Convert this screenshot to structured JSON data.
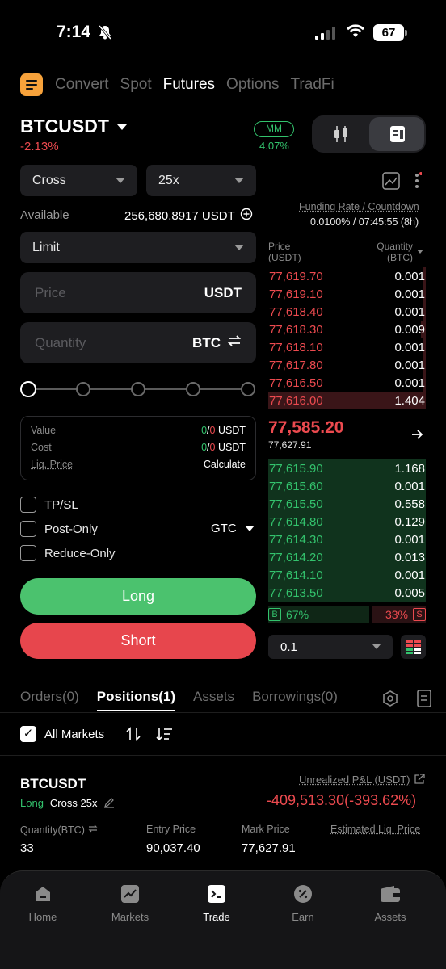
{
  "status": {
    "time": "7:14",
    "battery": "67"
  },
  "nav": {
    "items": [
      "Convert",
      "Spot",
      "Futures",
      "Options",
      "TradFi"
    ],
    "active": "Futures"
  },
  "symbol": {
    "name": "BTCUSDT",
    "change": "-2.13%",
    "mm_label": "MM",
    "mm_value": "4.07%"
  },
  "order": {
    "margin_mode": "Cross",
    "leverage": "25x",
    "available_label": "Available",
    "available_value": "256,680.8917 USDT",
    "order_type": "Limit",
    "price_placeholder": "Price",
    "price_unit": "USDT",
    "qty_placeholder": "Quantity",
    "qty_unit": "BTC",
    "summary": {
      "value_label": "Value",
      "value_a": "0",
      "value_b": "0",
      "value_unit": "USDT",
      "cost_label": "Cost",
      "cost_a": "0",
      "cost_b": "0",
      "cost_unit": "USDT",
      "liq_label": "Liq. Price",
      "liq_action": "Calculate"
    },
    "tpsl": "TP/SL",
    "post_only": "Post-Only",
    "reduce_only": "Reduce-Only",
    "tif": "GTC",
    "long_label": "Long",
    "short_label": "Short"
  },
  "funding": {
    "label": "Funding Rate / Countdown",
    "value": "0.0100% / 07:45:55 (8h)"
  },
  "orderbook": {
    "price_header_1": "Price",
    "price_header_2": "(USDT)",
    "qty_header_1": "Quantity",
    "qty_header_2": "(BTC)",
    "asks": [
      {
        "p": "77,619.70",
        "q": "0.001",
        "depth": 0.02
      },
      {
        "p": "77,619.10",
        "q": "0.001",
        "depth": 0.02
      },
      {
        "p": "77,618.40",
        "q": "0.001",
        "depth": 0.02
      },
      {
        "p": "77,618.30",
        "q": "0.009",
        "depth": 0.03
      },
      {
        "p": "77,618.10",
        "q": "0.001",
        "depth": 0.02
      },
      {
        "p": "77,617.80",
        "q": "0.001",
        "depth": 0.02
      },
      {
        "p": "77,616.50",
        "q": "0.001",
        "depth": 0.02
      },
      {
        "p": "77,616.00",
        "q": "1.404",
        "depth": 1.0
      }
    ],
    "last_price": "77,585.20",
    "mark_price": "77,627.91",
    "bids": [
      {
        "p": "77,615.90",
        "q": "1.168",
        "depth": 1.0
      },
      {
        "p": "77,615.60",
        "q": "0.001",
        "depth": 1.0
      },
      {
        "p": "77,615.50",
        "q": "0.558",
        "depth": 1.0
      },
      {
        "p": "77,614.80",
        "q": "0.129",
        "depth": 1.0
      },
      {
        "p": "77,614.30",
        "q": "0.001",
        "depth": 1.0
      },
      {
        "p": "77,614.20",
        "q": "0.013",
        "depth": 1.0
      },
      {
        "p": "77,614.10",
        "q": "0.001",
        "depth": 1.0
      },
      {
        "p": "77,613.50",
        "q": "0.005",
        "depth": 1.0
      }
    ],
    "buy_tag": "B",
    "buy_pct": "67%",
    "sell_tag": "S",
    "sell_pct": "33%",
    "depth_step": "0.1"
  },
  "tabs": {
    "orders": "Orders(0)",
    "positions": "Positions(1)",
    "assets": "Assets",
    "borrowings": "Borrowings(0)"
  },
  "filter": {
    "all_markets": "All Markets"
  },
  "position": {
    "symbol": "BTCUSDT",
    "side": "Long",
    "mode": "Cross 25x",
    "upl_label": "Unrealized P&L (USDT)",
    "upl_value": "-409,513.30(-393.62%)",
    "qty_label": "Quantity(BTC)",
    "qty_value": "33",
    "entry_label": "Entry Price",
    "entry_value": "90,037.40",
    "mark_label": "Mark Price",
    "mark_value": "77,627.91",
    "liq_label": "Estimated Liq. Price"
  },
  "tabbar": [
    "Home",
    "Markets",
    "Trade",
    "Earn",
    "Assets"
  ],
  "colors": {
    "green": "#33c36d",
    "red": "#ec4a4f",
    "accent": "#f7a23b"
  }
}
